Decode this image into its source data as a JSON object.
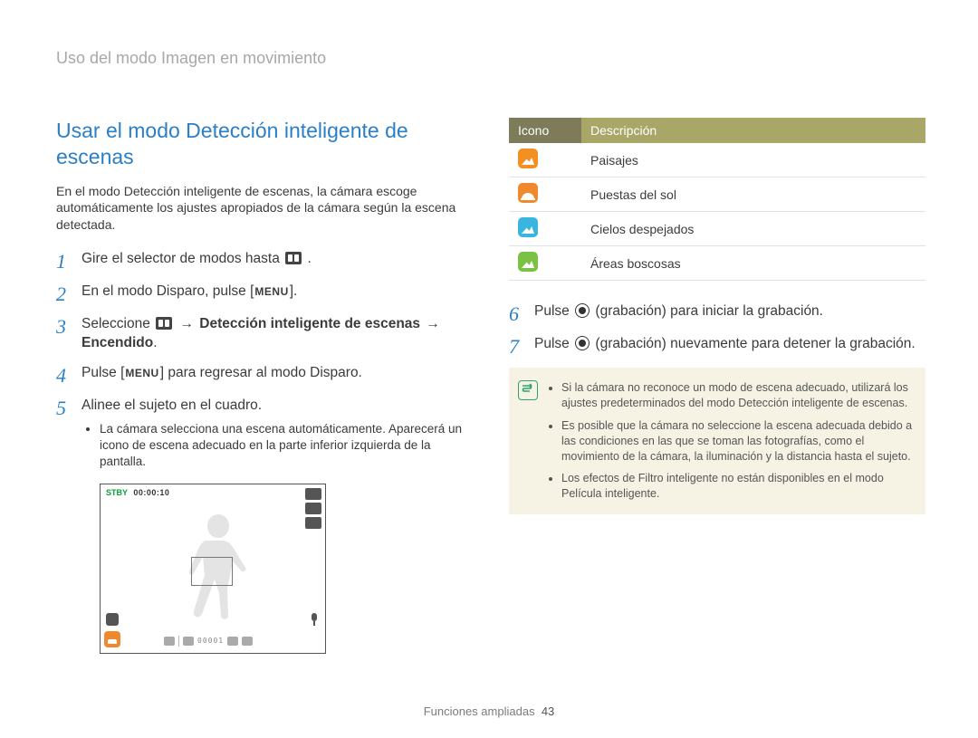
{
  "header": {
    "breadcrumb": "Uso del modo Imagen en movimiento"
  },
  "left": {
    "title": "Usar el modo Detección inteligente de escenas",
    "intro": "En el modo Detección inteligente de escenas, la cámara escoge automáticamente los ajustes apropiados de la cámara según la escena detectada.",
    "steps": {
      "s1": {
        "num": "1",
        "pre": "Gire el selector de modos hasta ",
        "post": "."
      },
      "s2": {
        "num": "2",
        "pre": "En el modo Disparo, pulse [",
        "menu": "MENU",
        "post": "]."
      },
      "s3": {
        "num": "3",
        "pre": "Seleccione ",
        "arrow": "→",
        "mid": " Detección inteligente de escenas ",
        "post": " Encendido",
        "tail": "."
      },
      "s4": {
        "num": "4",
        "pre": "Pulse [",
        "menu": "MENU",
        "post": "] para regresar al modo Disparo."
      },
      "s5": {
        "num": "5",
        "text": "Alinee el sujeto en el cuadro.",
        "sub1": "La cámara selecciona una escena automáticamente. Aparecerá un icono de escena adecuado en la parte inferior izquierda de la pantalla."
      }
    },
    "screen": {
      "stby_label": "STBY",
      "stby_time": "00:00:10",
      "counter": "00001"
    }
  },
  "right": {
    "table": {
      "head_icon": "Icono",
      "head_desc": "Descripción",
      "r1": "Paisajes",
      "r2": "Puestas del sol",
      "r3": "Cielos despejados",
      "r4": "Áreas boscosas"
    },
    "steps": {
      "s6": {
        "num": "6",
        "pre": "Pulse ",
        "post": " (grabación) para iniciar la grabación."
      },
      "s7": {
        "num": "7",
        "pre": "Pulse ",
        "post": " (grabación) nuevamente para detener la grabación."
      }
    },
    "notes": {
      "n1": "Si la cámara no reconoce un modo de escena adecuado, utilizará los ajustes predeterminados del modo Detección inteligente de escenas.",
      "n2": "Es posible que la cámara no seleccione la escena adecuada debido a las condiciones en las que se toman las fotografías, como el movimiento de la cámara, la iluminación y la distancia hasta el sujeto.",
      "n3": "Los efectos de Filtro inteligente no están disponibles en el modo Película inteligente."
    }
  },
  "footer": {
    "section": "Funciones ampliadas",
    "page": "43"
  }
}
